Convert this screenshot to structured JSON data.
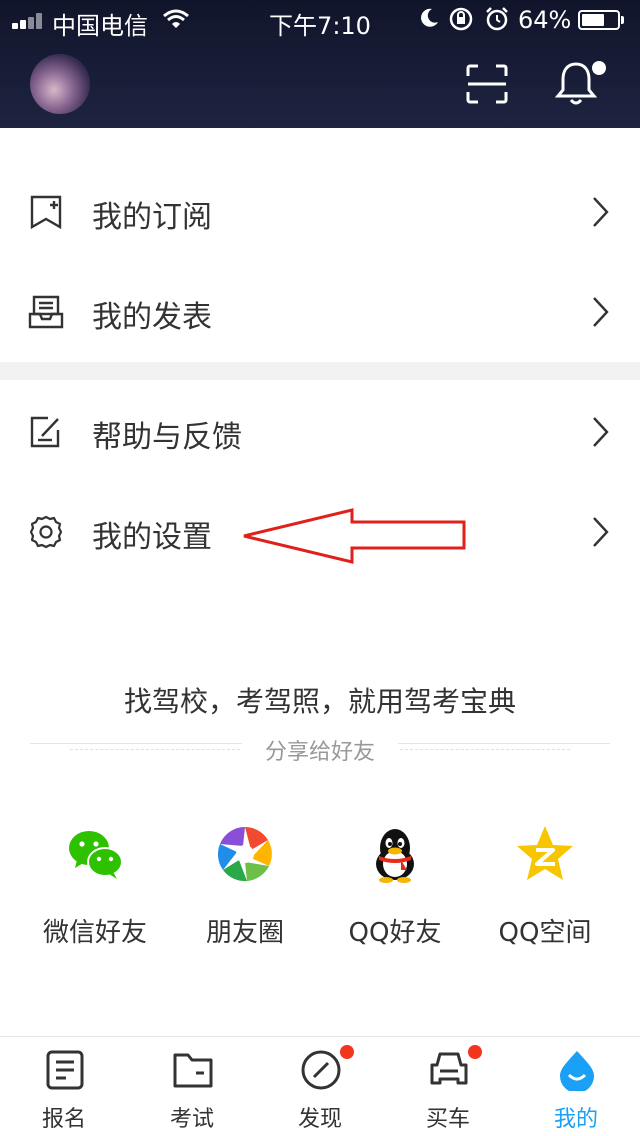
{
  "status_bar": {
    "carrier": "中国电信",
    "time": "下午7:10",
    "battery_percent": "64%",
    "battery_level": 0.64,
    "icons": [
      "signal-icon",
      "wifi-icon",
      "moon-icon",
      "rotation-lock-icon",
      "alarm-icon",
      "battery-icon"
    ]
  },
  "header": {
    "icons": [
      "avatar",
      "scan-icon",
      "bell-icon"
    ],
    "has_notification": true
  },
  "menu": {
    "items": [
      {
        "label": "我的订阅",
        "icon": "bookmark-plus-icon"
      },
      {
        "label": "我的发表",
        "icon": "inbox-icon"
      },
      {
        "label": "帮助与反馈",
        "icon": "edit-icon"
      },
      {
        "label": "我的设置",
        "icon": "gear-icon"
      }
    ]
  },
  "annotation": {
    "color": "#e0201a"
  },
  "share": {
    "slogan": "找驾校，考驾照，就用驾考宝典",
    "title": "分享给好友",
    "items": [
      {
        "label": "微信好友",
        "icon": "wechat-icon"
      },
      {
        "label": "朋友圈",
        "icon": "moments-icon"
      },
      {
        "label": "QQ好友",
        "icon": "qq-icon"
      },
      {
        "label": "QQ空间",
        "icon": "qzone-icon"
      }
    ]
  },
  "tabbar": {
    "items": [
      {
        "label": "报名",
        "icon": "signup-icon",
        "badge": false,
        "active": false
      },
      {
        "label": "考试",
        "icon": "exam-icon",
        "badge": false,
        "active": false
      },
      {
        "label": "发现",
        "icon": "discover-icon",
        "badge": true,
        "active": false
      },
      {
        "label": "买车",
        "icon": "car-icon",
        "badge": true,
        "active": false
      },
      {
        "label": "我的",
        "icon": "profile-icon",
        "badge": false,
        "active": true
      }
    ]
  },
  "colors": {
    "header_bg": "#161b33",
    "accent": "#1aa1f5",
    "badge": "#f2361e",
    "wechat": "#2dc100",
    "qzone": "#f7c600"
  }
}
